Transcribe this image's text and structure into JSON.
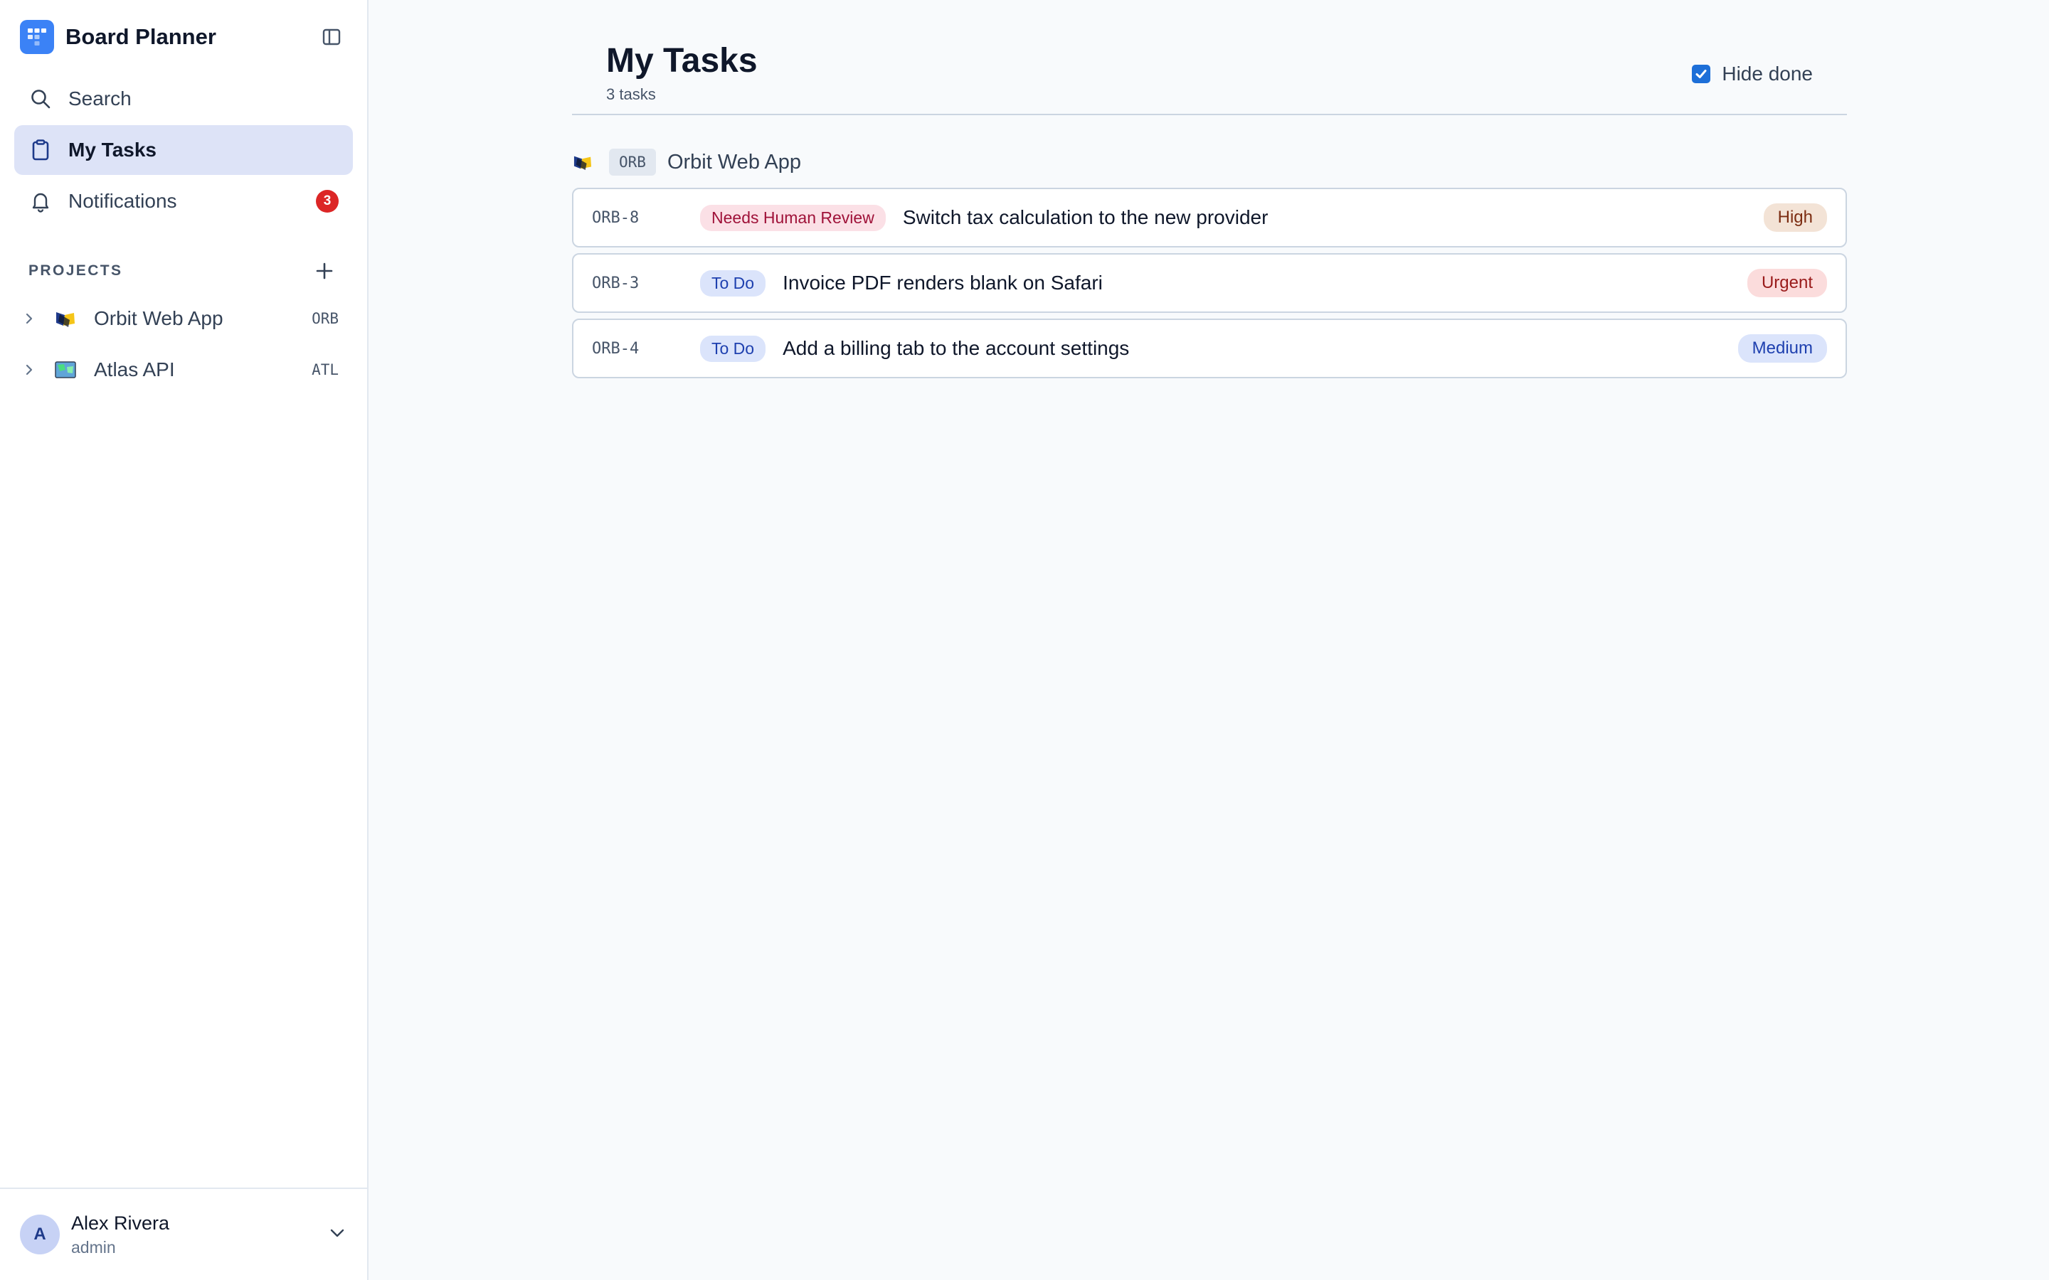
{
  "app": {
    "title": "Board Planner"
  },
  "nav": {
    "items": [
      {
        "label": "Search",
        "icon": "search-icon"
      },
      {
        "label": "My Tasks",
        "icon": "clipboard-icon",
        "active": true
      },
      {
        "label": "Notifications",
        "icon": "bell-icon",
        "badge": "3"
      }
    ]
  },
  "projects": {
    "header": "PROJECTS",
    "items": [
      {
        "name": "Orbit Web App",
        "key": "ORB",
        "icon": "orbit-project-icon"
      },
      {
        "name": "Atlas API",
        "key": "ATL",
        "icon": "atlas-project-icon"
      }
    ]
  },
  "user": {
    "initial": "A",
    "name": "Alex Rivera",
    "role": "admin"
  },
  "page": {
    "title": "My Tasks",
    "subtitle": "3 tasks",
    "hide_done_label": "Hide done",
    "hide_done_checked": true
  },
  "group": {
    "key": "ORB",
    "name": "Orbit Web App"
  },
  "tasks": [
    {
      "id": "ORB-8",
      "status": "Needs Human Review",
      "title": "Switch tax calculation to the new provider",
      "priority": "High"
    },
    {
      "id": "ORB-3",
      "status": "To Do",
      "title": "Invoice PDF renders blank on Safari",
      "priority": "Urgent"
    },
    {
      "id": "ORB-4",
      "status": "To Do",
      "title": "Add a billing tab to the account settings",
      "priority": "Medium"
    }
  ],
  "colors": {
    "accent": "#3b82f6",
    "active_nav_bg": "#dde3f7",
    "badge_red": "#dc2626",
    "status_review_bg": "#fbe0e6",
    "status_review_fg": "#9f1239",
    "status_todo_bg": "#dbe4fb",
    "status_todo_fg": "#1e40af",
    "priority_high_bg": "#f3e3d6",
    "priority_high_fg": "#7c2d12",
    "priority_urgent_bg": "#fbdcdc",
    "priority_urgent_fg": "#991b1b",
    "priority_medium_bg": "#dbe4fb",
    "priority_medium_fg": "#1e40af"
  }
}
